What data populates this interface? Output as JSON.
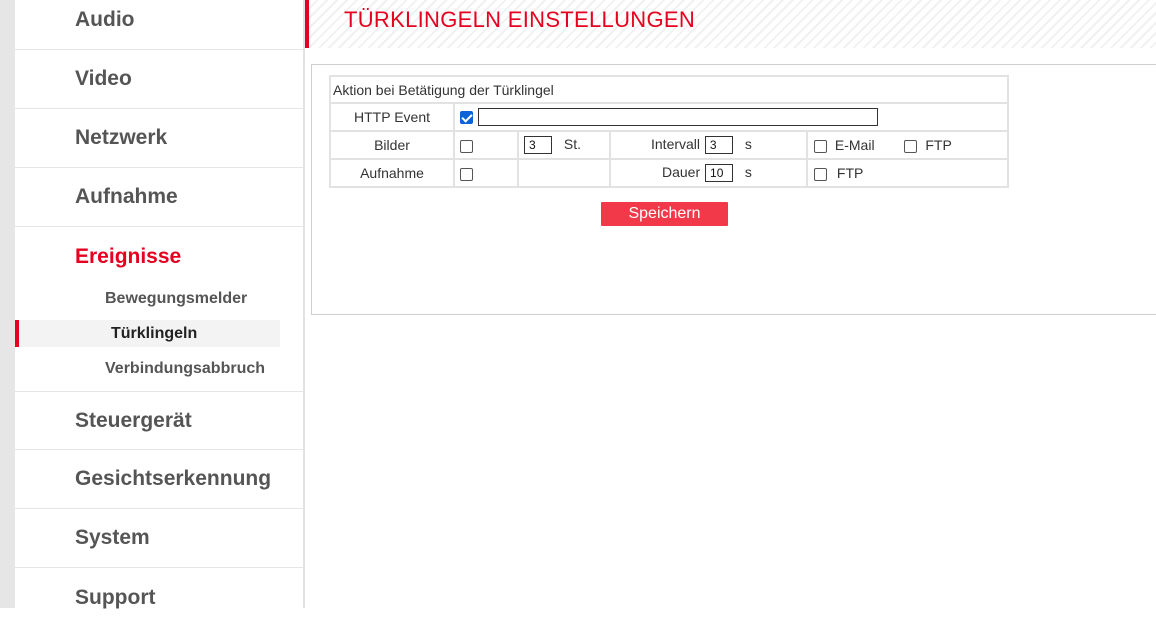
{
  "sidebar": {
    "items": [
      {
        "label": "Audio"
      },
      {
        "label": "Video"
      },
      {
        "label": "Netzwerk"
      },
      {
        "label": "Aufnahme"
      },
      {
        "label": "Ereignisse",
        "active": true
      },
      {
        "label": "Steuergerät"
      },
      {
        "label": "Gesichtserkennung"
      },
      {
        "label": "System"
      },
      {
        "label": "Support"
      }
    ],
    "subitems": [
      {
        "label": "Bewegungsmelder"
      },
      {
        "label": "Türklingeln",
        "selected": true
      },
      {
        "label": "Verbindungsabbruch"
      }
    ]
  },
  "header": {
    "title": "TÜRKLINGELN EINSTELLUNGEN"
  },
  "form": {
    "caption": "Aktion bei Betätigung der Türklingel",
    "http_event": {
      "label": "HTTP Event",
      "checked": true,
      "value": ""
    },
    "bilder": {
      "label": "Bilder",
      "checked": false,
      "count": "3",
      "count_unit": "St.",
      "interval_label": "Intervall",
      "interval": "3",
      "interval_unit": "s",
      "email_label": "E-Mail",
      "email_checked": false,
      "ftp_label": "FTP",
      "ftp_checked": false
    },
    "aufnahme": {
      "label": "Aufnahme",
      "checked": false,
      "duration_label": "Dauer",
      "duration": "10",
      "duration_unit": "s",
      "ftp_label": "FTP",
      "ftp_checked": false
    },
    "save_label": "Speichern"
  },
  "colors": {
    "accent": "#e6001f",
    "button": "#f2394a",
    "checkbox_checked": "#0a64d8"
  }
}
